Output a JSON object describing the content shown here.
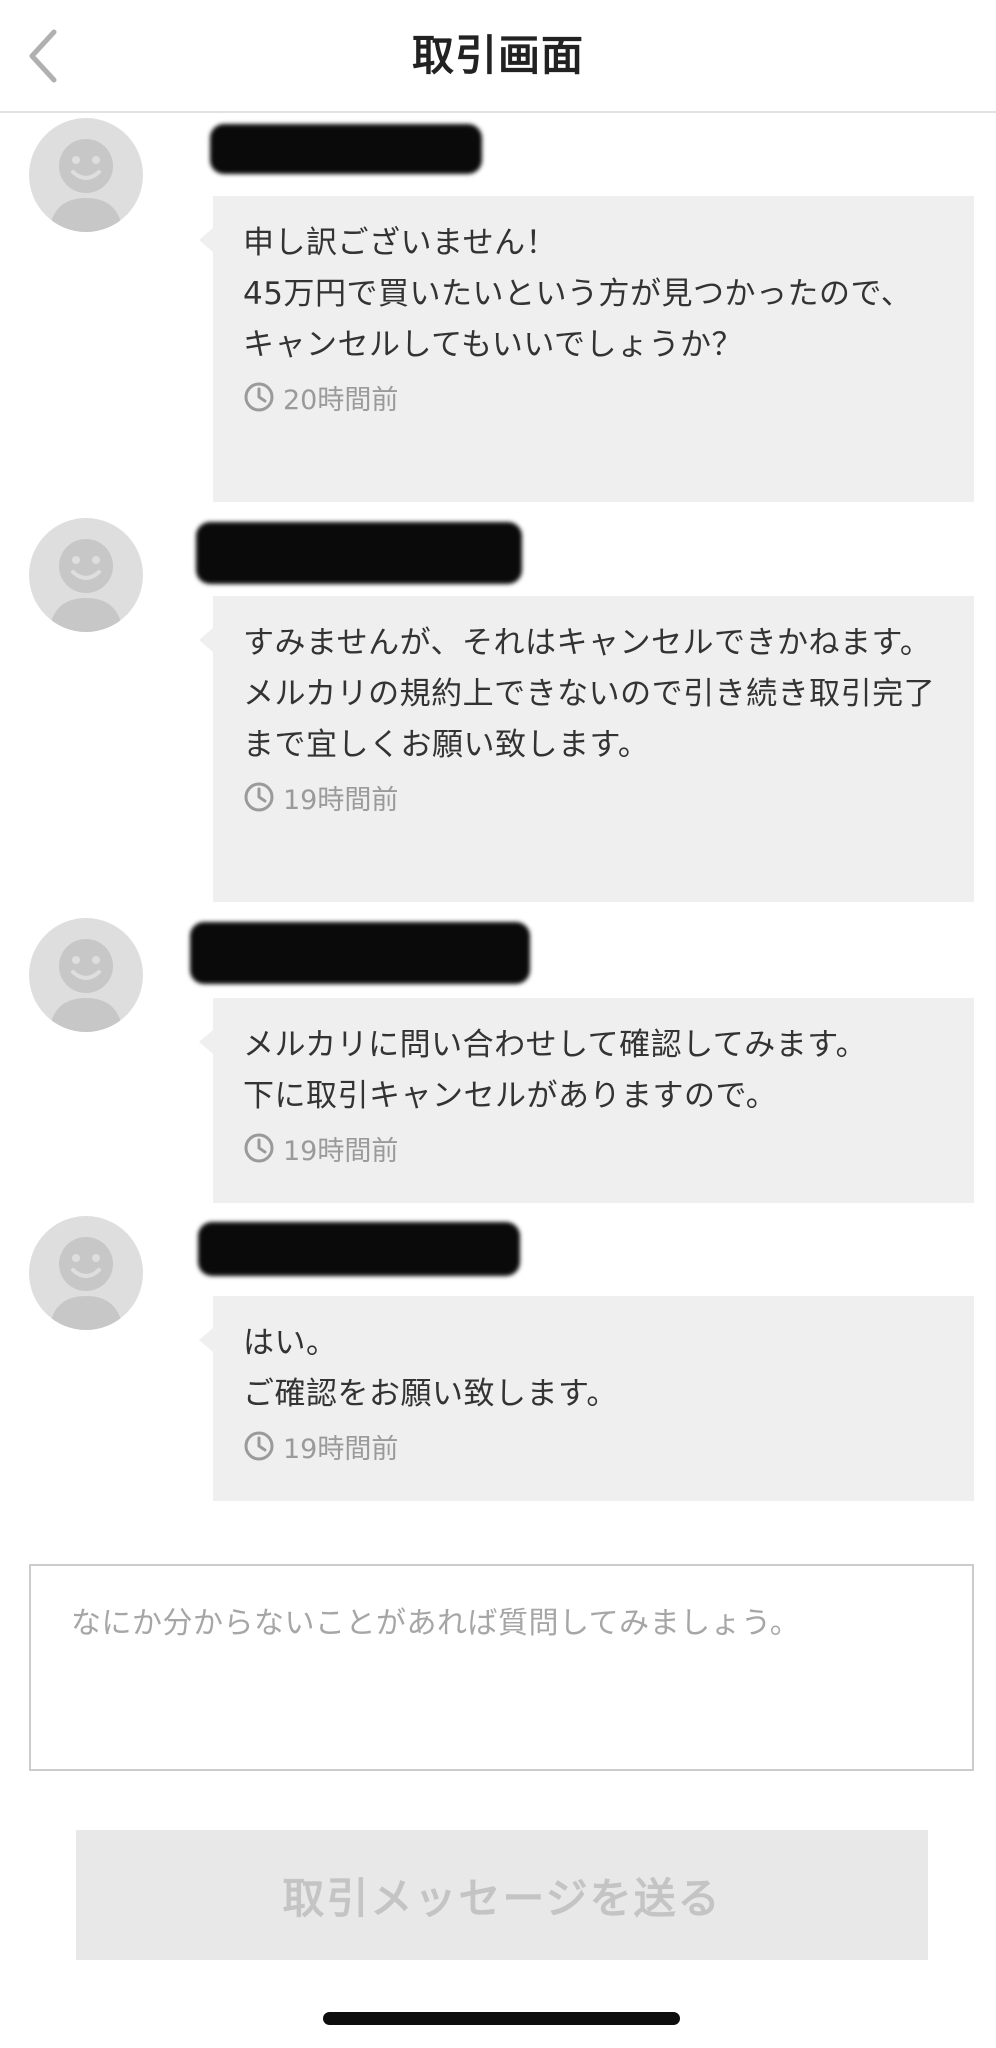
{
  "header": {
    "title": "取引画面",
    "back_icon": "chevron-left-icon"
  },
  "messages": [
    {
      "text": "申し訳ございません！\n45万円で買いたいという方が見つかったので、\nキャンセルしてもいいでしょうか？",
      "time": "20時間前"
    },
    {
      "text": "すみませんが、それはキャンセルできかねます。\nメルカリの規約上できないので引き続き取引完了まで宜しくお願い致します。",
      "time": "19時間前"
    },
    {
      "text": "メルカリに問い合わせして確認してみます。\n下に取引キャンセルがありますので。",
      "time": "19時間前"
    },
    {
      "text": "はい。\nご確認をお願い致します。",
      "time": "19時間前"
    }
  ],
  "input": {
    "placeholder": "なにか分からないことがあれば質問してみましょう。"
  },
  "send_button": {
    "label": "取引メッセージを送る"
  },
  "colors": {
    "bubble_bg": "#efefef",
    "avatar_bg": "#dedede",
    "avatar_fg": "#c7c7c7",
    "button_bg": "#e8e8e8",
    "button_text": "#c4c4c4"
  }
}
